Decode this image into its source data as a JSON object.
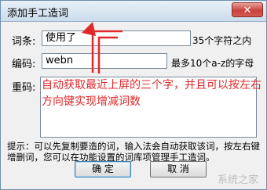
{
  "window": {
    "title": "添加手工造词",
    "close_glyph": "✕"
  },
  "form": {
    "term_label": "词条:",
    "term_value": "使用了",
    "term_hint": "35个字符之内",
    "code_label": "编码:",
    "code_value": "webn",
    "code_hint": "最多10个a-z的字母",
    "weight_label": "重码:"
  },
  "annotation": "自动获取最近上屏的三个字，并且可以按左右方向键实现增减词数",
  "tip": "提示：可以先复制要造的词，输入法会自动获取该词，按左右键增删词，您可以在功能设置的词库项管理手工造词。",
  "buttons": {
    "ok": "确 定",
    "cancel": "取 消"
  },
  "watermark": "系统之家",
  "colors": {
    "annotation": "#e0282a",
    "arrow": "#e0282a"
  }
}
